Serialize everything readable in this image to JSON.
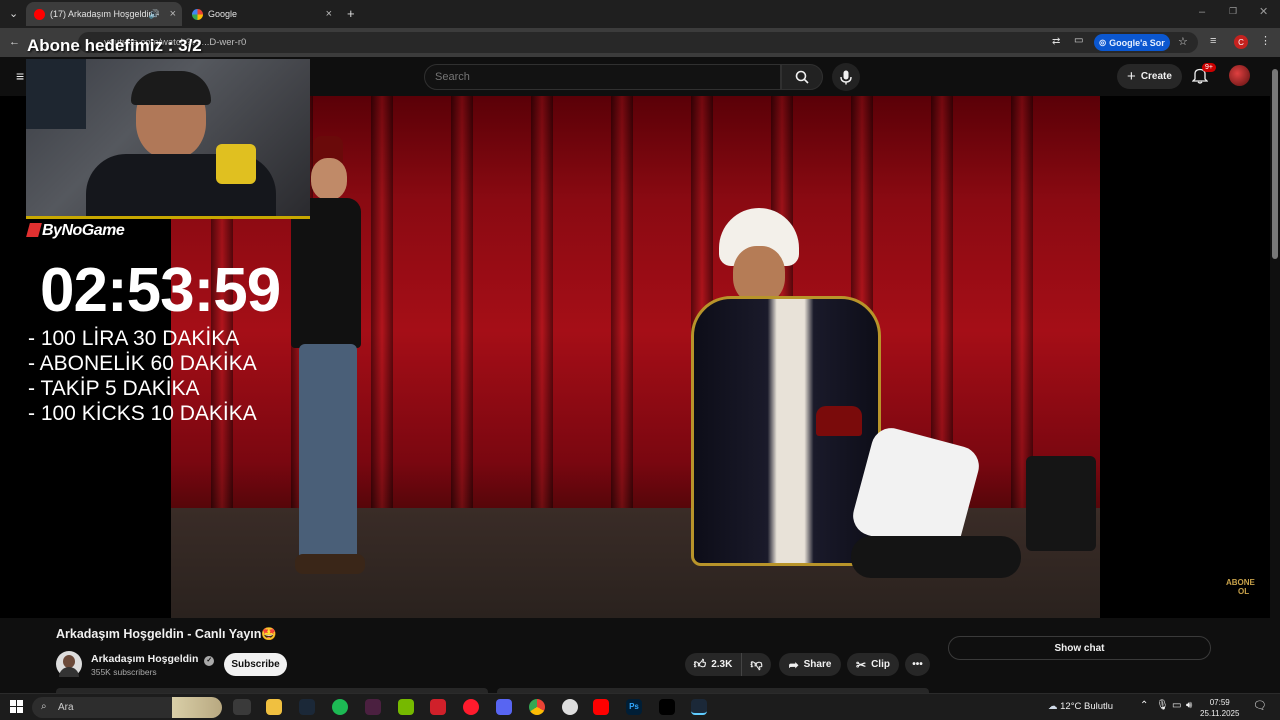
{
  "browser": {
    "tabs": [
      {
        "title": "(17) Arkadaşım Hoşgeldin -",
        "active": true
      },
      {
        "title": "Google",
        "active": false
      }
    ],
    "url": "youtube.com/watch?v=...D-wer-r0",
    "google_ask_label": "Google'a Sor"
  },
  "youtube": {
    "search_placeholder": "Search",
    "create_label": "Create",
    "notifications_badge": "9+"
  },
  "overlay": {
    "title": "Abone hedefimiz : 3/2",
    "brand": "ByNoGame",
    "timer": "02:53:59",
    "rules": [
      "- 100 LİRA 30 DAKİKA",
      "- ABONELİK 60 DAKİKA",
      "- TAKİP 5 DAKİKA",
      "- 100 KİCKS 10 DAKİKA"
    ],
    "corner_logo": [
      "ABONE",
      "OL"
    ]
  },
  "video": {
    "title": "Arkadaşım Hoşgeldin - Canlı Yayın🤩",
    "channel": "Arkadaşım Hoşgeldin",
    "subscribers": "355K subscribers",
    "subscribe_label": "Subscribe",
    "likes": "2.3K",
    "share_label": "Share",
    "clip_label": "Clip",
    "show_chat_label": "Show chat"
  },
  "taskbar": {
    "search_label": "Ara",
    "weather": "12°C  Bulutlu",
    "time": "07:59",
    "date": "25.11.2025"
  },
  "colors": {
    "background": "#0f0f0f",
    "youtube_red": "#ff0000",
    "curtain": "#a50e17",
    "google_ask": "#0b57d0"
  }
}
